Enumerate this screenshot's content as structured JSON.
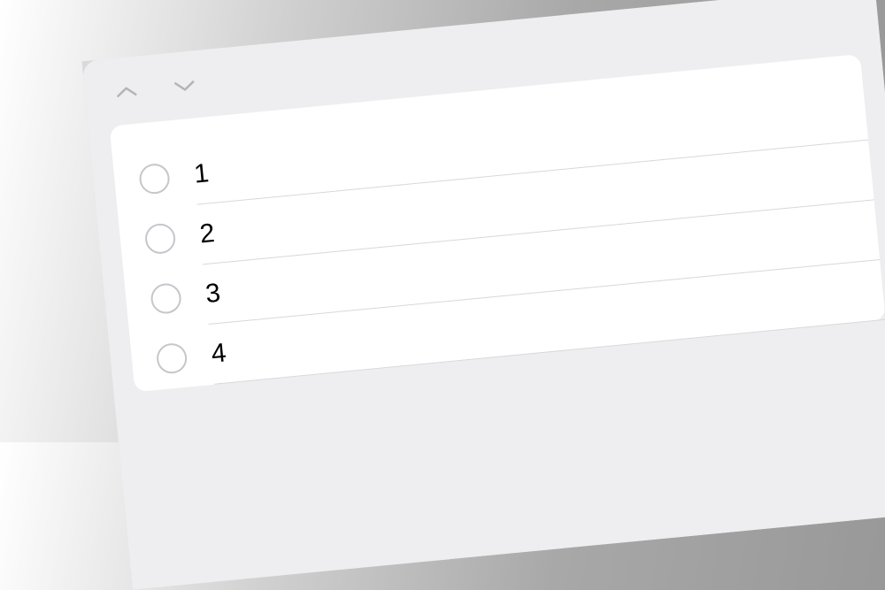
{
  "list": {
    "items": [
      {
        "label": "1"
      },
      {
        "label": "2"
      },
      {
        "label": "3"
      },
      {
        "label": "4"
      }
    ]
  }
}
